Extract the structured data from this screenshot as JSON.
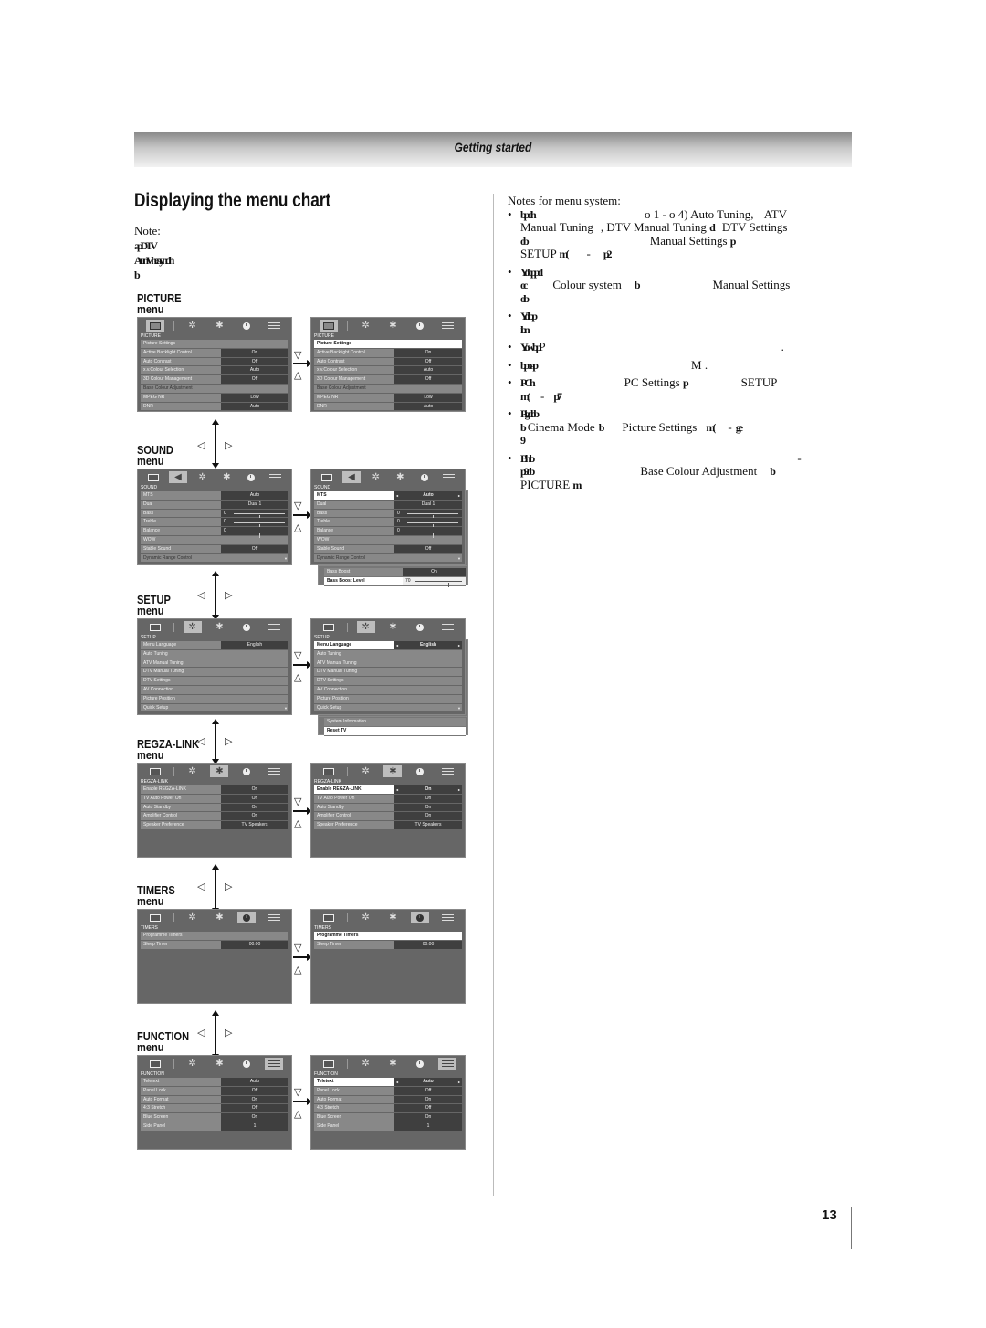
{
  "header": {
    "section_title": "Getting started"
  },
  "page_title": "Displaying the menu chart",
  "left_note": {
    "label": "Note:",
    "line1": "ap DTV",
    "line2": "Aun V heayn dh",
    "line3": "b"
  },
  "right_notes": {
    "heading": "Notes for menu system:",
    "items": [
      {
        "prefix": "bpdh",
        "parts": [
          "o 1 - o 4)",
          "Auto Tuning,",
          "ATV",
          "Manual Tuning",
          ", DTV Manual Tuning",
          "d",
          "DTV Settings",
          "ob",
          "Manual Settings",
          "p",
          "SETUP",
          "m(",
          "-",
          "p2"
        ]
      },
      {
        "prefix": "Yobppd",
        "parts": [
          "oc",
          "Colour system",
          "b",
          "Manual Settings",
          "oib"
        ]
      },
      {
        "prefix": "Yoltbp",
        "parts": [
          "ibn"
        ]
      },
      {
        "prefix": "Yowbp",
        "parts": [
          "P",
          "."
        ]
      },
      {
        "prefix": "bpoap",
        "parts": [
          "M ."
        ]
      },
      {
        "prefix": "PCh",
        "parts": [
          "PC Settings",
          "p",
          "SETUP",
          "m(",
          "-",
          "p7"
        ]
      },
      {
        "prefix": "Pigdob",
        "parts": [
          "b",
          "Cinema Mode",
          "b",
          "Picture Settings",
          "m(",
          "-",
          "ge",
          "9"
        ]
      },
      {
        "prefix": "Bhtb",
        "parts": [
          "-",
          "p9ob",
          "Base Colour Adjustment",
          "b",
          "PICTURE",
          "m"
        ]
      }
    ]
  },
  "nav_glyphs": {
    "left": "◁",
    "right": "▷",
    "down": "▽",
    "up": "△"
  },
  "icons": {
    "picture": "tv-icon",
    "sound": "speaker-icon",
    "setup": "gear-icon",
    "regza": "star-icon",
    "timers": "clock-icon",
    "function": "sliders-icon",
    "glyph_sound": "◀",
    "glyph_setup": "✲",
    "glyph_regza": "✱",
    "arrow_left": "◂",
    "arrow_right": "▸",
    "scroll_down": "▼"
  },
  "menus": {
    "picture": {
      "label": "PICTURE",
      "sub": "menu",
      "section": "PICTURE",
      "rows": [
        {
          "label": "Picture Settings",
          "value": ""
        },
        {
          "label": "Active Backlight Control",
          "value": "On"
        },
        {
          "label": "Auto Contrast",
          "value": "Off"
        },
        {
          "label": "x.v.Colour Selection",
          "value": "Auto"
        },
        {
          "label": "3D Colour Management",
          "value": "Off"
        },
        {
          "label": "Base Colour Adjustment",
          "value": ""
        },
        {
          "label": "MPEG NR",
          "value": "Low"
        },
        {
          "label": "DNR",
          "value": "Auto"
        }
      ]
    },
    "sound": {
      "label": "SOUND",
      "sub": "menu",
      "section": "SOUND",
      "rows": [
        {
          "label": "MTS",
          "value": "Auto"
        },
        {
          "label": "Dual",
          "value": "Dual 1"
        },
        {
          "label": "Bass",
          "value": "0"
        },
        {
          "label": "Treble",
          "value": "0"
        },
        {
          "label": "Balance",
          "value": "0"
        },
        {
          "label": "WOW",
          "value": ""
        },
        {
          "label": "Stable Sound",
          "value": "Off"
        },
        {
          "label": "Dynamic Range Control",
          "value": ""
        }
      ],
      "extra_rows": [
        {
          "label": "Bass Boost",
          "value": "On"
        },
        {
          "label": "Bass Boost Level",
          "value": "70"
        }
      ]
    },
    "setup": {
      "label": "SETUP",
      "sub": "menu",
      "section": "SETUP",
      "rows": [
        {
          "label": "Menu Language",
          "value": "English"
        },
        {
          "label": "Auto Tuning",
          "value": ""
        },
        {
          "label": "ATV Manual Tuning",
          "value": ""
        },
        {
          "label": "DTV Manual Tuning",
          "value": ""
        },
        {
          "label": "DTV Settings",
          "value": ""
        },
        {
          "label": "AV Connection",
          "value": ""
        },
        {
          "label": "Picture Position",
          "value": ""
        },
        {
          "label": "Quick Setup",
          "value": ""
        }
      ],
      "extra_rows": [
        {
          "label": "System Information",
          "value": ""
        },
        {
          "label": "Reset TV",
          "value": ""
        }
      ]
    },
    "regza": {
      "label": "REGZA-LINK",
      "sub": "menu",
      "section": "REGZA-LINK",
      "rows": [
        {
          "label": "Enable REGZA-LINK",
          "value": "On"
        },
        {
          "label": "TV Auto Power On",
          "value": "On"
        },
        {
          "label": "Auto Standby",
          "value": "On"
        },
        {
          "label": "Amplifier Control",
          "value": "On"
        },
        {
          "label": "Speaker Preference",
          "value": "TV Speakers"
        }
      ]
    },
    "timers": {
      "label": "TIMERS",
      "sub": "menu",
      "section": "TIMERS",
      "rows": [
        {
          "label": "Programme Timers",
          "value": ""
        },
        {
          "label": "Sleep Timer",
          "value": "00:00"
        }
      ]
    },
    "function": {
      "label": "FUNCTION",
      "sub": "menu",
      "section": "FUNCTION",
      "rows": [
        {
          "label": "Teletext",
          "value": "Auto"
        },
        {
          "label": "Panel Lock",
          "value": "Off"
        },
        {
          "label": "Auto Format",
          "value": "On"
        },
        {
          "label": "4:3 Stretch",
          "value": "Off"
        },
        {
          "label": "Blue Screen",
          "value": "On"
        },
        {
          "label": "Side Panel",
          "value": "1"
        }
      ]
    }
  },
  "slider_values": {
    "bass": 0.5,
    "treble": 0.5,
    "balance": 0.5,
    "bass_boost_level": 0.7
  },
  "page_number": "13"
}
